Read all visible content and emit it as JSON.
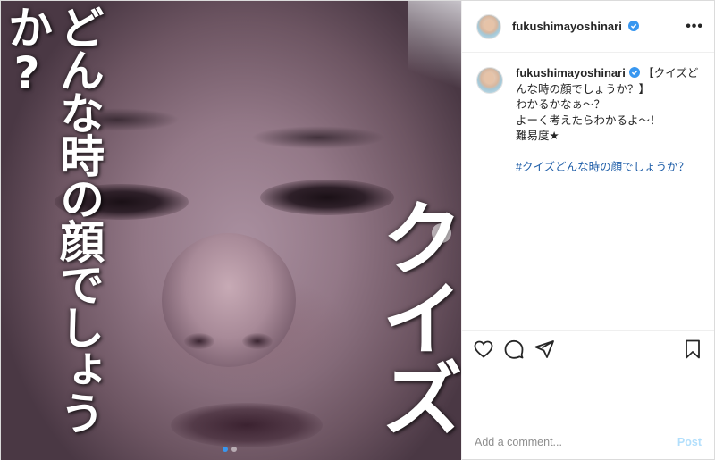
{
  "media": {
    "overlay_question": "どんな時の顔でしょうか?",
    "overlay_quiz": "クイズ",
    "carousel": {
      "count": 2,
      "active_index": 0
    }
  },
  "header": {
    "username": "fukushimayoshinari",
    "verified": true,
    "more_icon": "more-horizontal-icon"
  },
  "caption": {
    "username": "fukushimayoshinari",
    "text": " 【クイズどんな時の顔でしょうか？】\nわかるかなぁ〜？\nよーく考えたらわかるよ〜！\n難易度★",
    "hashtag": "#クイズどんな時の顔でしょうか？"
  },
  "actions": {
    "icons": [
      "heart-icon",
      "comment-icon",
      "share-icon",
      "bookmark-icon"
    ]
  },
  "comment_box": {
    "placeholder": "Add a comment...",
    "post_label": "Post"
  },
  "colors": {
    "verified": "#3897f0",
    "hashtag": "#1f5ea8",
    "post_disabled": "#b2dffc"
  }
}
